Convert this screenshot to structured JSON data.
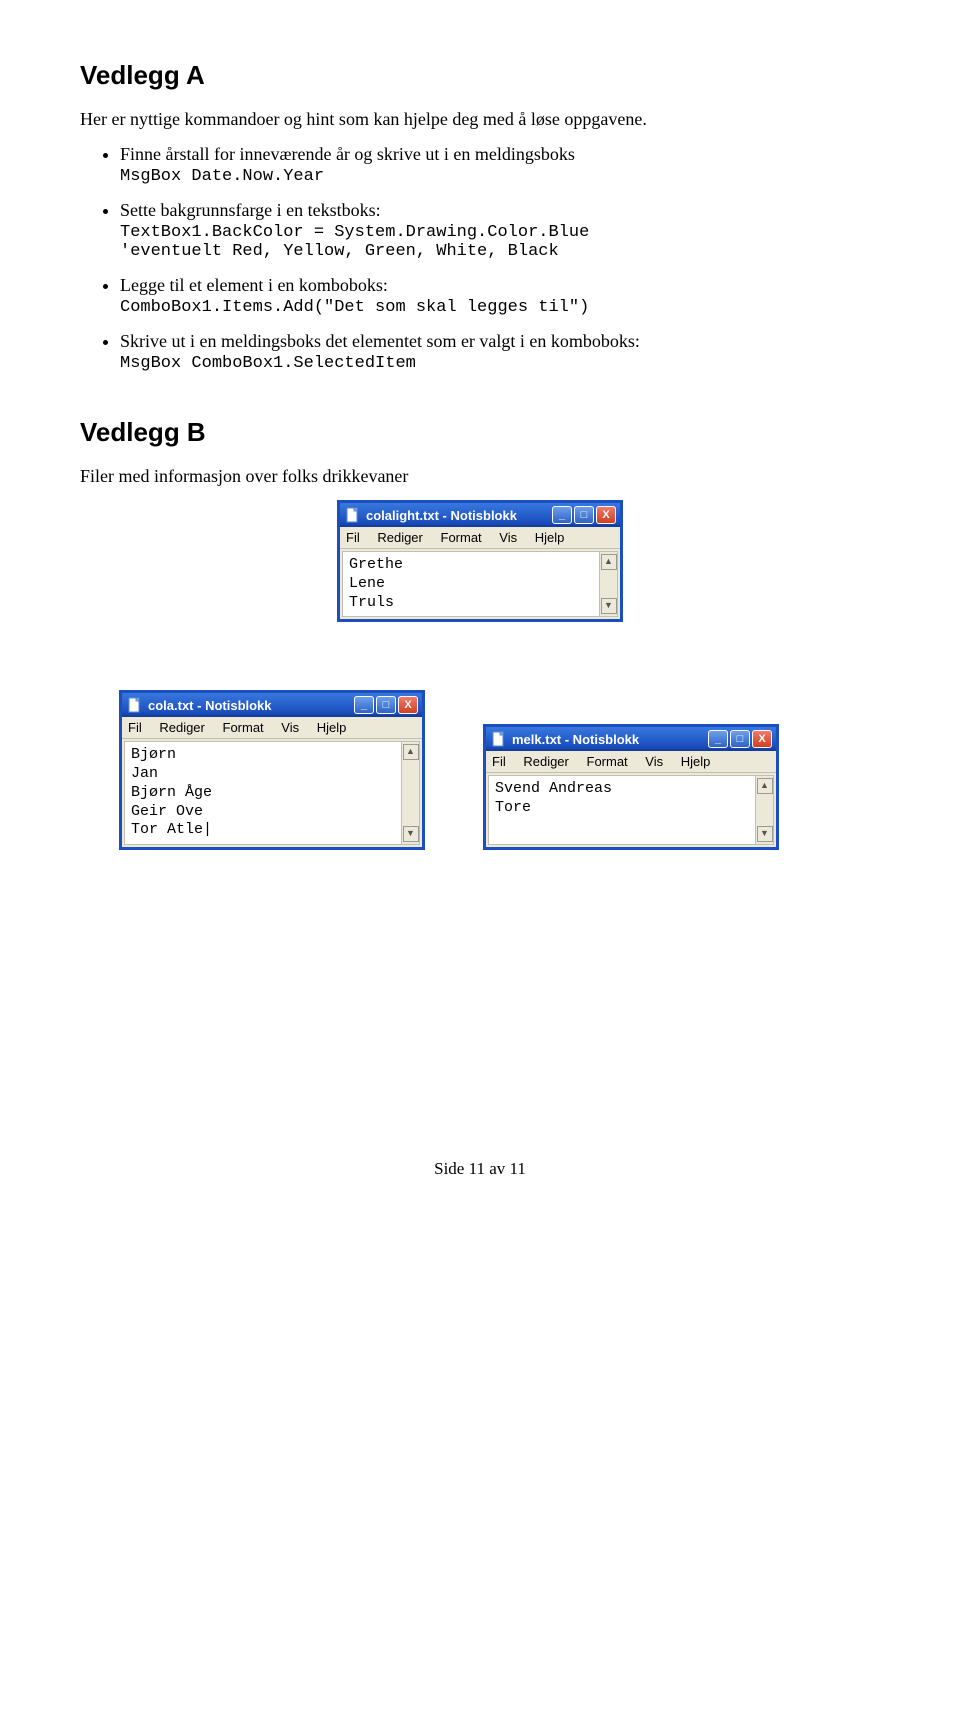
{
  "sectionA": {
    "title": "Vedlegg A",
    "intro": "Her er nyttige kommandoer og hint som kan hjelpe deg med å løse oppgavene.",
    "bullets": [
      {
        "text": "Finne årstall for inneværende år og skrive ut i en meldingsboks",
        "code": "MsgBox Date.Now.Year"
      },
      {
        "text": "Sette bakgrunnsfarge i en tekstboks:",
        "code": "TextBox1.BackColor = System.Drawing.Color.Blue\n'eventuelt Red, Yellow, Green, White, Black"
      },
      {
        "text": "Legge til et element i en komboboks:",
        "code": "ComboBox1.Items.Add(\"Det som skal legges til\")"
      },
      {
        "text": "Skrive ut i en meldingsboks det elementet som er valgt i en komboboks:",
        "code": "MsgBox ComboBox1.SelectedItem"
      }
    ]
  },
  "sectionB": {
    "title": "Vedlegg B",
    "intro": "Filer med informasjon over folks drikkevaner"
  },
  "menus": {
    "fil": "Fil",
    "rediger": "Rediger",
    "format": "Format",
    "vis": "Vis",
    "hjelp": "Hjelp"
  },
  "windows": {
    "colalight": {
      "title": "colalight.txt - Notisblokk",
      "content": "Grethe\nLene\nTruls"
    },
    "cola": {
      "title": "cola.txt - Notisblokk",
      "content": "Bjørn\nJan\nBjørn Åge\nGeir Ove\nTor Atle|"
    },
    "melk": {
      "title": "melk.txt - Notisblokk",
      "content": "Svend Andreas\nTore"
    }
  },
  "footer": "Side 11 av 11"
}
